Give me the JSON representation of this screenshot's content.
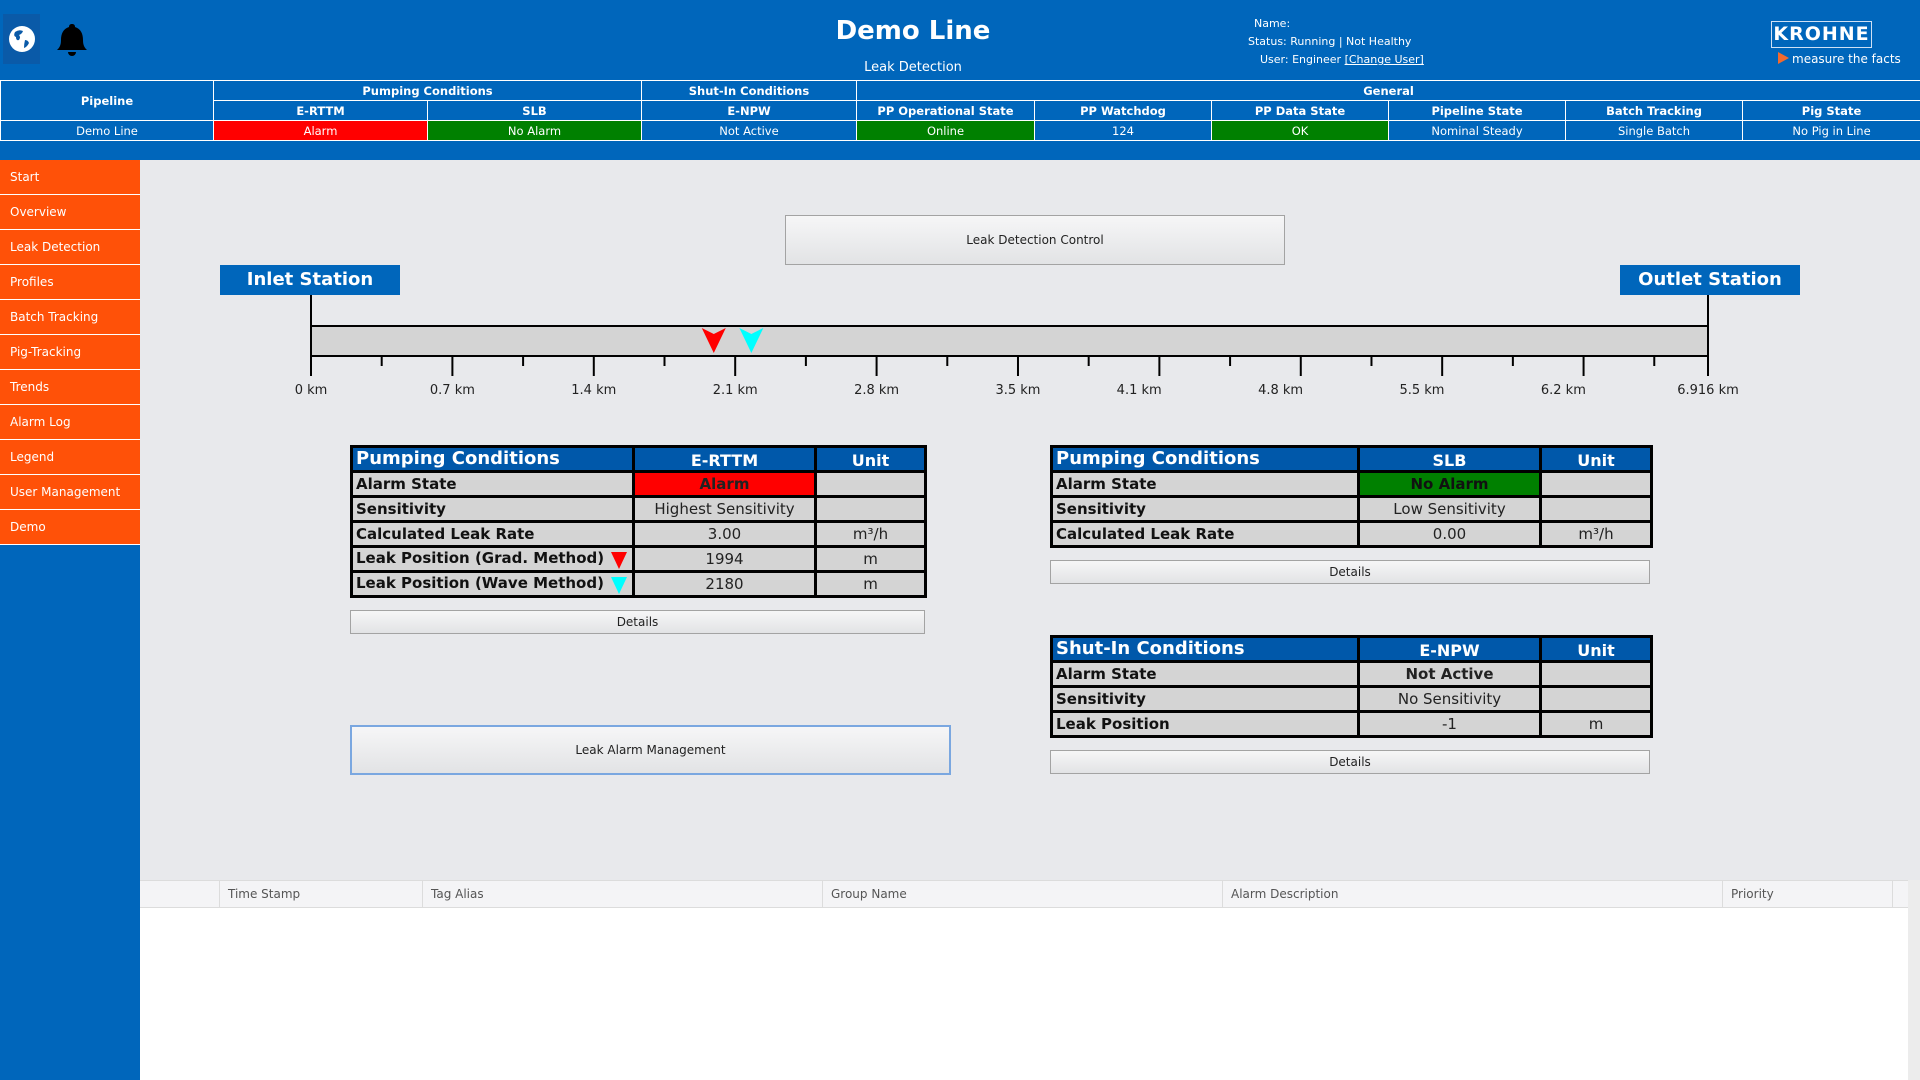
{
  "header": {
    "title": "Demo Line",
    "subtitle": "Leak Detection",
    "name_label": "Name:",
    "status_text": "Status: Running | Not Healthy",
    "user_text": "User: Engineer",
    "change_user_link": "[Change User]",
    "logo_text": "KROHNE",
    "tagline": "measure the facts"
  },
  "status_table": {
    "group_headers": {
      "pipeline": "Pipeline",
      "pumping": "Pumping Conditions",
      "shutin": "Shut-In Conditions",
      "general": "General"
    },
    "columns": [
      {
        "header": "E-RTTM",
        "value": "Alarm",
        "color": "#ff0000"
      },
      {
        "header": "SLB",
        "value": "No Alarm",
        "color": "#008000"
      },
      {
        "header": "E-NPW",
        "value": "Not Active",
        "color": ""
      },
      {
        "header": "PP Operational State",
        "value": "Online",
        "color": "#008000"
      },
      {
        "header": "PP Watchdog",
        "value": "124",
        "color": ""
      },
      {
        "header": "PP Data State",
        "value": "OK",
        "color": "#008000"
      },
      {
        "header": "Pipeline State",
        "value": "Nominal Steady",
        "color": ""
      },
      {
        "header": "Batch Tracking",
        "value": "Single Batch",
        "color": ""
      },
      {
        "header": "Pig State",
        "value": "No Pig in Line",
        "color": ""
      }
    ],
    "pipeline_value": "Demo Line"
  },
  "sidebar": {
    "items": [
      {
        "label": "Start"
      },
      {
        "label": "Overview"
      },
      {
        "label": "Leak Detection"
      },
      {
        "label": "Profiles"
      },
      {
        "label": "Batch Tracking"
      },
      {
        "label": "Pig-Tracking"
      },
      {
        "label": "Trends"
      },
      {
        "label": "Alarm Log"
      },
      {
        "label": "Legend"
      },
      {
        "label": "User Management"
      },
      {
        "label": "Demo"
      }
    ]
  },
  "main": {
    "leak_detection_control": "Leak Detection Control",
    "leak_alarm_management": "Leak Alarm Management",
    "details_label": "Details"
  },
  "pipeline": {
    "inlet": "Inlet Station",
    "outlet": "Outlet Station",
    "length_km": 6.916,
    "tick_labels": [
      "0 km",
      "0.7 km",
      "1.4 km",
      "2.1 km",
      "2.8 km",
      "3.5 km",
      "4.1 km",
      "4.8 km",
      "5.5 km",
      "6.2 km",
      "6.916 km"
    ],
    "markers": [
      {
        "name": "grad-method",
        "position_m": 1994,
        "color": "#ff0000"
      },
      {
        "name": "wave-method",
        "position_m": 2180,
        "color": "#00ffff"
      }
    ]
  },
  "tables": {
    "ertm": {
      "title": "Pumping Conditions",
      "col": "E-RTTM",
      "unit_col": "Unit",
      "rows": [
        {
          "label": "Alarm State",
          "value": "Alarm",
          "unit": ""
        },
        {
          "label": "Sensitivity",
          "value": "Highest Sensitivity",
          "unit": ""
        },
        {
          "label": "Calculated Leak Rate",
          "value": "3.00",
          "unit": "m³/h"
        },
        {
          "label": "Leak Position (Grad. Method)",
          "value": "1994",
          "unit": "m"
        },
        {
          "label": "Leak Position (Wave Method)",
          "value": "2180",
          "unit": "m"
        }
      ]
    },
    "slb": {
      "title": "Pumping Conditions",
      "col": "SLB",
      "unit_col": "Unit",
      "rows": [
        {
          "label": "Alarm State",
          "value": "No Alarm",
          "unit": ""
        },
        {
          "label": "Sensitivity",
          "value": "Low Sensitivity",
          "unit": ""
        },
        {
          "label": "Calculated Leak Rate",
          "value": "0.00",
          "unit": "m³/h"
        }
      ]
    },
    "enpw": {
      "title": "Shut-In Conditions",
      "col": "E-NPW",
      "unit_col": "Unit",
      "rows": [
        {
          "label": "Alarm State",
          "value": "Not Active",
          "unit": ""
        },
        {
          "label": "Sensitivity",
          "value": "No Sensitivity",
          "unit": ""
        },
        {
          "label": "Leak Position",
          "value": "-1",
          "unit": "m"
        }
      ]
    }
  },
  "alarm_grid": {
    "columns": [
      "",
      "Time Stamp",
      "Tag Alias",
      "Group Name",
      "Alarm Description",
      "Priority"
    ]
  }
}
